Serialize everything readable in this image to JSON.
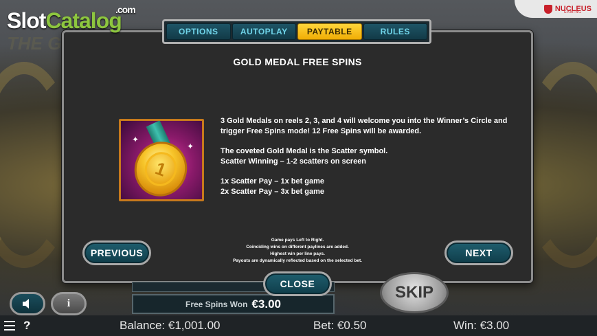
{
  "brand": {
    "watermark_slot": "Slot",
    "watermark_catalog": "Catalog",
    "watermark_com": ".com",
    "game_logo": "THE GAMES",
    "provider": "NUCLEUS",
    "provider_sub": "GAMING"
  },
  "tabs": [
    {
      "label": "OPTIONS",
      "active": false
    },
    {
      "label": "AUTOPLAY",
      "active": false
    },
    {
      "label": "PAYTABLE",
      "active": true
    },
    {
      "label": "RULES",
      "active": false
    }
  ],
  "paytable": {
    "title": "GOLD MEDAL FREE SPINS",
    "symbol_icon": "gold-medal",
    "paragraph1": "3 Gold Medals on reels 2, 3, and 4 will welcome you into the Winner’s Circle and trigger Free Spins mode! 12 Free Spins will be awarded.",
    "paragraph2_line1": "The coveted Gold Medal is the Scatter symbol.",
    "paragraph2_line2": "Scatter Winning – 1-2 scatters on screen",
    "pay_line1": "1x Scatter Pay – 1x bet game",
    "pay_line2": "2x Scatter Pay – 3x bet game",
    "notes": [
      "Game pays Left to Right.",
      "Coinciding wins on different paylines are added.",
      "Highest win per line pays.",
      "Payouts are dynamically reflected based on the selected bet."
    ]
  },
  "buttons": {
    "previous": "PREVIOUS",
    "next": "NEXT",
    "close": "CLOSE",
    "skip": "SKIP",
    "info": "i"
  },
  "free_spins": {
    "label": "Free Spins Won",
    "value": "€3.00"
  },
  "status": {
    "help": "?",
    "balance": "Balance: €1,001.00",
    "bet": "Bet: €0.50",
    "win": "Win: €3.00"
  },
  "colors": {
    "tab_active": "#f5b50a",
    "tab_text": "#6fd3e8",
    "button_teal": "#1f5e6e",
    "dialog_bg": "#2b2b2b"
  }
}
